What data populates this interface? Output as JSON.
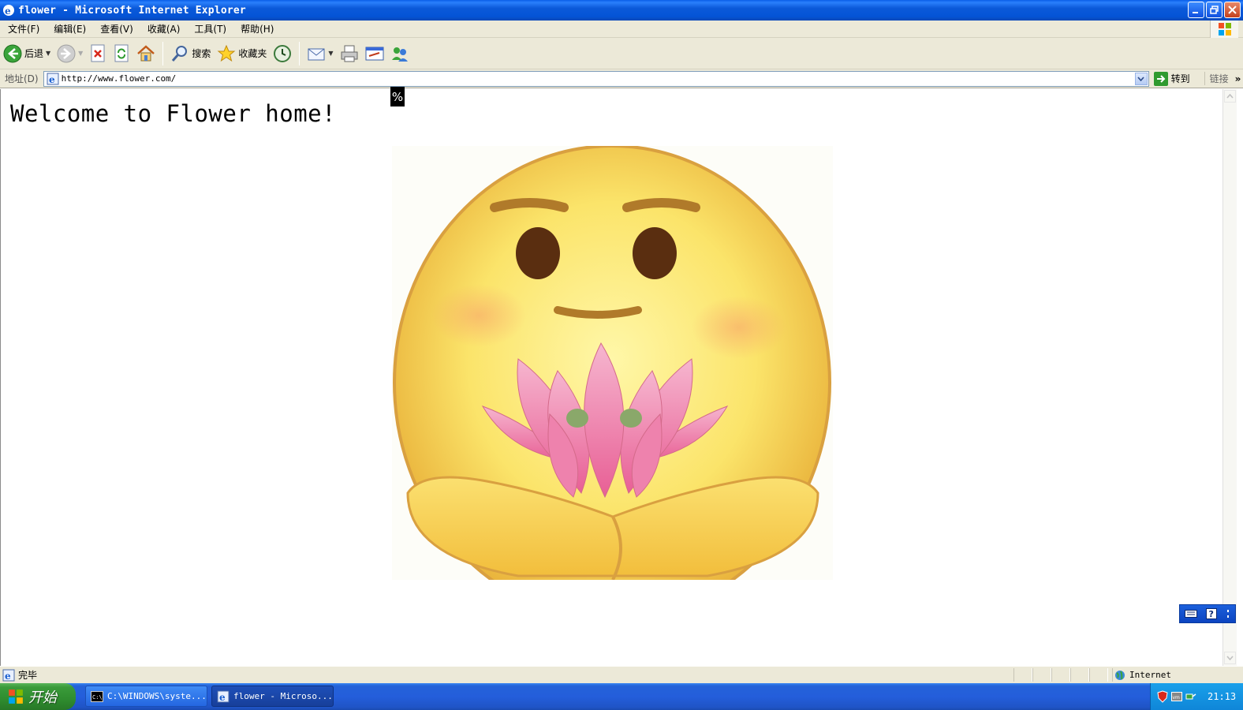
{
  "window": {
    "title": "flower - Microsoft Internet Explorer"
  },
  "menu": {
    "items": [
      "文件(F)",
      "编辑(E)",
      "查看(V)",
      "收藏(A)",
      "工具(T)",
      "帮助(H)"
    ]
  },
  "toolbar": {
    "back_label": "后退",
    "search_label": "搜索",
    "favorites_label": "收藏夹"
  },
  "address": {
    "label": "地址(D)",
    "url": "http://www.flower.com/",
    "go_label": "转到",
    "links_label": "链接",
    "links_chevron": "»"
  },
  "page": {
    "heading": "Welcome to Flower home!",
    "overlay_text": "%"
  },
  "status": {
    "text": "完毕",
    "zone": "Internet"
  },
  "taskbar": {
    "start_label": "开始",
    "tasks": [
      "C:\\WINDOWS\\syste...",
      "flower - Microso..."
    ],
    "clock": "21:13"
  },
  "colors": {
    "titlebar": "#0454d6",
    "chrome": "#ece9d8",
    "taskbar": "#245edb",
    "start": "#3a9b3a"
  }
}
